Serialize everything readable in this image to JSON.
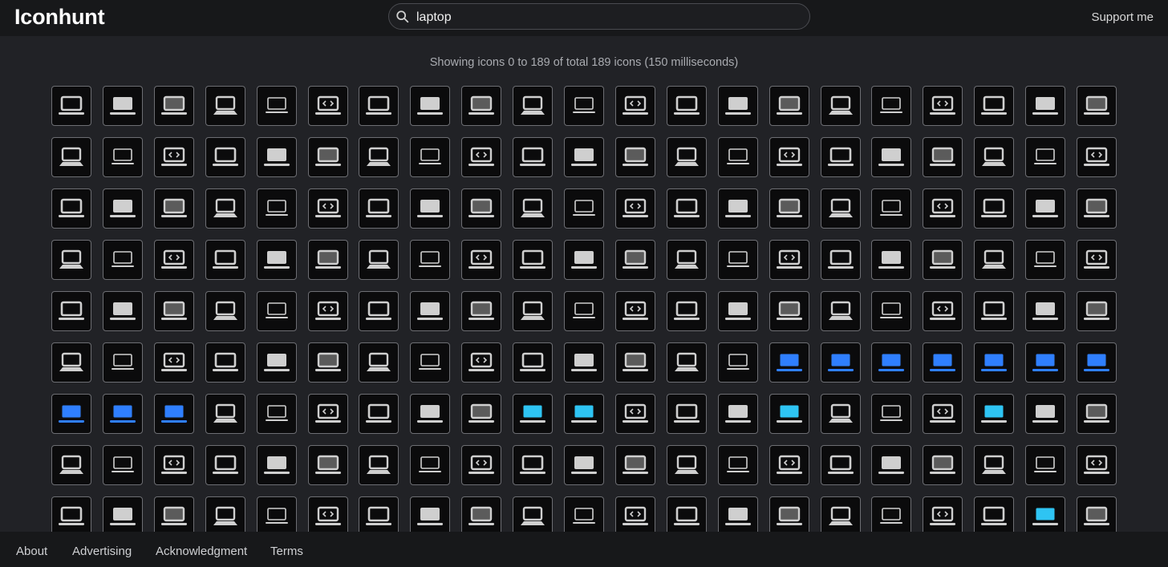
{
  "header": {
    "logo": "Iconhunt",
    "search_value": "laptop",
    "search_icon": "search-icon",
    "support_label": "Support me"
  },
  "status_text": "Showing icons 0 to 189 of total 189 icons (150 milliseconds)",
  "grid": {
    "columns": 21,
    "visible_rows": 9,
    "visible_tiles": 189,
    "tile_icon": "laptop-icon",
    "accent_colors": {
      "icon_gray": "#cfcfcf",
      "blue": "#2f7fff",
      "light_blue": "#2ec4f3"
    }
  },
  "footer": {
    "links": [
      "About",
      "Advertising",
      "Acknowledgment",
      "Terms"
    ]
  }
}
